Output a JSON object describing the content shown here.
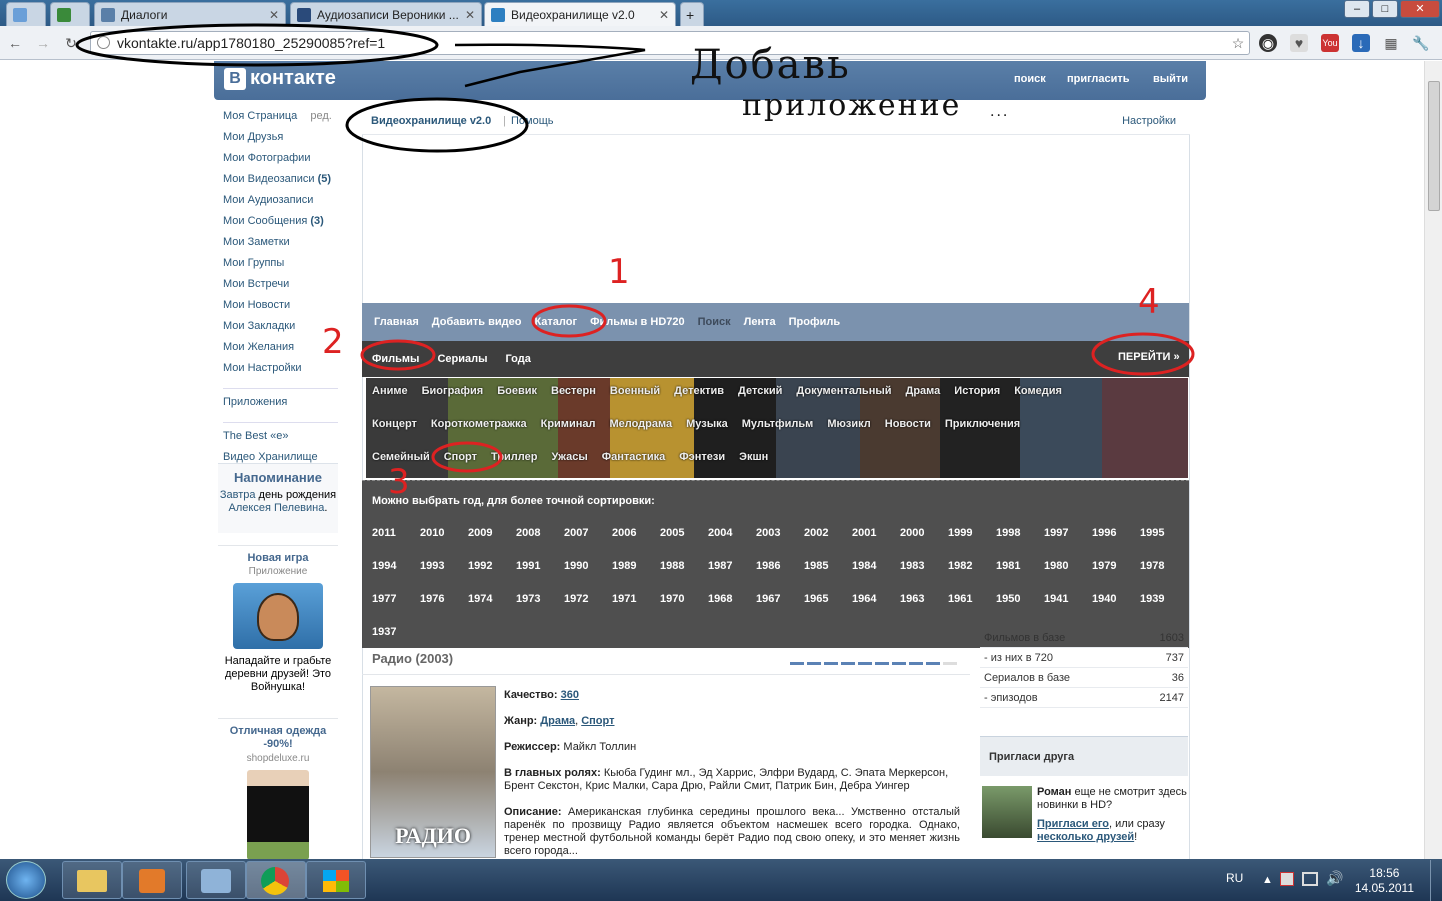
{
  "browser": {
    "tabs": [
      {
        "label": "",
        "active": false
      },
      {
        "label": "",
        "active": false
      },
      {
        "label": "Диалоги",
        "active": false
      },
      {
        "label": "Аудиозаписи Вероники ...",
        "active": false
      },
      {
        "label": "Видеохранилище v2.0",
        "active": true
      }
    ],
    "url": "vkontakte.ru/app1780180_25290085?ref=1"
  },
  "vk": {
    "logo": "контакте",
    "header_links": [
      "поиск",
      "пригласить",
      "выйти"
    ],
    "menu": [
      {
        "label": "Моя Страница",
        "extra": "ред."
      },
      {
        "label": "Мои Друзья"
      },
      {
        "label": "Мои Фотографии"
      },
      {
        "label": "Мои Видеозаписи",
        "count": "(5)"
      },
      {
        "label": "Мои Аудиозаписи"
      },
      {
        "label": "Мои Сообщения",
        "count": "(3)"
      },
      {
        "label": "Мои Заметки"
      },
      {
        "label": "Мои Группы"
      },
      {
        "label": "Мои Встречи"
      },
      {
        "label": "Мои Новости"
      },
      {
        "label": "Мои Закладки"
      },
      {
        "label": "Мои Желания"
      },
      {
        "label": "Мои Настройки"
      }
    ],
    "apps_label": "Приложения",
    "apps": [
      "The Best «e»",
      "Видео Хранилище"
    ],
    "reminder": {
      "title": "Напоминание",
      "link": "Завтра",
      "text1": "день рождения",
      "name": "Алексея Пелевина",
      "dot": "."
    },
    "ad1": {
      "title": "Новая игра",
      "subtitle": "Приложение",
      "text": "Нападайте и грабьте деревни друзей! Это Войнушка!"
    },
    "ad2": {
      "title": "Отличная одежда -90%!",
      "subtitle": "shopdeluxe.ru"
    }
  },
  "app": {
    "name": "Видеохранилище v2.0",
    "sep": "|",
    "help": "Помощь",
    "settings": "Настройки",
    "nav": [
      "Главная",
      "Добавить видео",
      "Каталог",
      "Фильмы в HD720",
      "Поиск",
      "Лента",
      "Профиль"
    ],
    "subnav": [
      "Фильмы",
      "Сериалы",
      "Года"
    ],
    "goto": "ПЕРЕЙТИ »",
    "genres_row1": [
      "Аниме",
      "Биография",
      "Боевик",
      "Вестерн",
      "Военный",
      "Детектив",
      "Детский",
      "Документальный",
      "Драма",
      "История",
      "Комедия"
    ],
    "genres_row2": [
      "Концерт",
      "Короткометражка",
      "Криминал",
      "Мелодрама",
      "Музыка",
      "Мультфильм",
      "Мюзикл",
      "Новости",
      "Приключения"
    ],
    "genres_row3": [
      "Семейный",
      "Спорт",
      "Триллер",
      "Ужасы",
      "Фантастика",
      "Фэнтези",
      "Экшн"
    ],
    "years_note": "Можно выбрать год, для более точной сортировки:",
    "years": [
      [
        "2011",
        "2010",
        "2009",
        "2008",
        "2007",
        "2006",
        "2005",
        "2004",
        "2003",
        "2002",
        "2001",
        "2000",
        "1999",
        "1998",
        "1997",
        "1996",
        "1995"
      ],
      [
        "1994",
        "1993",
        "1992",
        "1991",
        "1990",
        "1989",
        "1988",
        "1987",
        "1986",
        "1985",
        "1984",
        "1983",
        "1982",
        "1981",
        "1980",
        "1979",
        "1978"
      ],
      [
        "1977",
        "1976",
        "1974",
        "1973",
        "1972",
        "1971",
        "1970",
        "1968",
        "1967",
        "1965",
        "1964",
        "1963",
        "1961",
        "1950",
        "1941",
        "1940",
        "1939"
      ],
      [
        "1937"
      ]
    ],
    "movie": {
      "title": "Радио (2003)",
      "poster_text": "РАДИО",
      "quality_label": "Качество:",
      "quality": "360",
      "genre_label": "Жанр:",
      "genre1": "Драма",
      "genre_sep": ",",
      "genre2": "Спорт",
      "director_label": "Режиссер:",
      "director": "Майкл Толлин",
      "cast_label": "В главных ролях:",
      "cast": "Кьюба Гудинг мл., Эд Харрис, Элфри Вудард, С. Эпата Меркерсон, Брент Секстон, Крис Малки, Сара Дрю, Райли Смит, Патрик Бин, Дебра Уингер",
      "desc_label": "Описание:",
      "desc": "Американская глубинка середины прошлого века... Умственно отсталый паренёк по прозвищу Радио является объектом насмешек всего городка. Однако, тренер местной футбольной команды берёт Радио под свою опеку, и это меняет жизнь всего города..."
    },
    "stats": [
      {
        "label": "Фильмов в базе",
        "value": "1603"
      },
      {
        "label": "- из них в 720",
        "value": "737"
      },
      {
        "label": "Сериалов в базе",
        "value": "36"
      },
      {
        "label": "- эпизодов",
        "value": "2147"
      }
    ],
    "invite": {
      "title": "Пригласи друга",
      "name": "Роман",
      "text": "еще не смотрит здесь новинки в HD?",
      "link1": "Пригласи его",
      "mid": ", или сразу",
      "link2": "несколько друзей",
      "end": "!"
    }
  },
  "annotations": {
    "handwriting1": "Добавь",
    "handwriting2": "приложение",
    "dots": "...",
    "n1": "1",
    "n2": "2",
    "n3": "3",
    "n4": "4"
  },
  "taskbar": {
    "lang": "RU",
    "time": "18:56",
    "date": "14.05.2011"
  }
}
